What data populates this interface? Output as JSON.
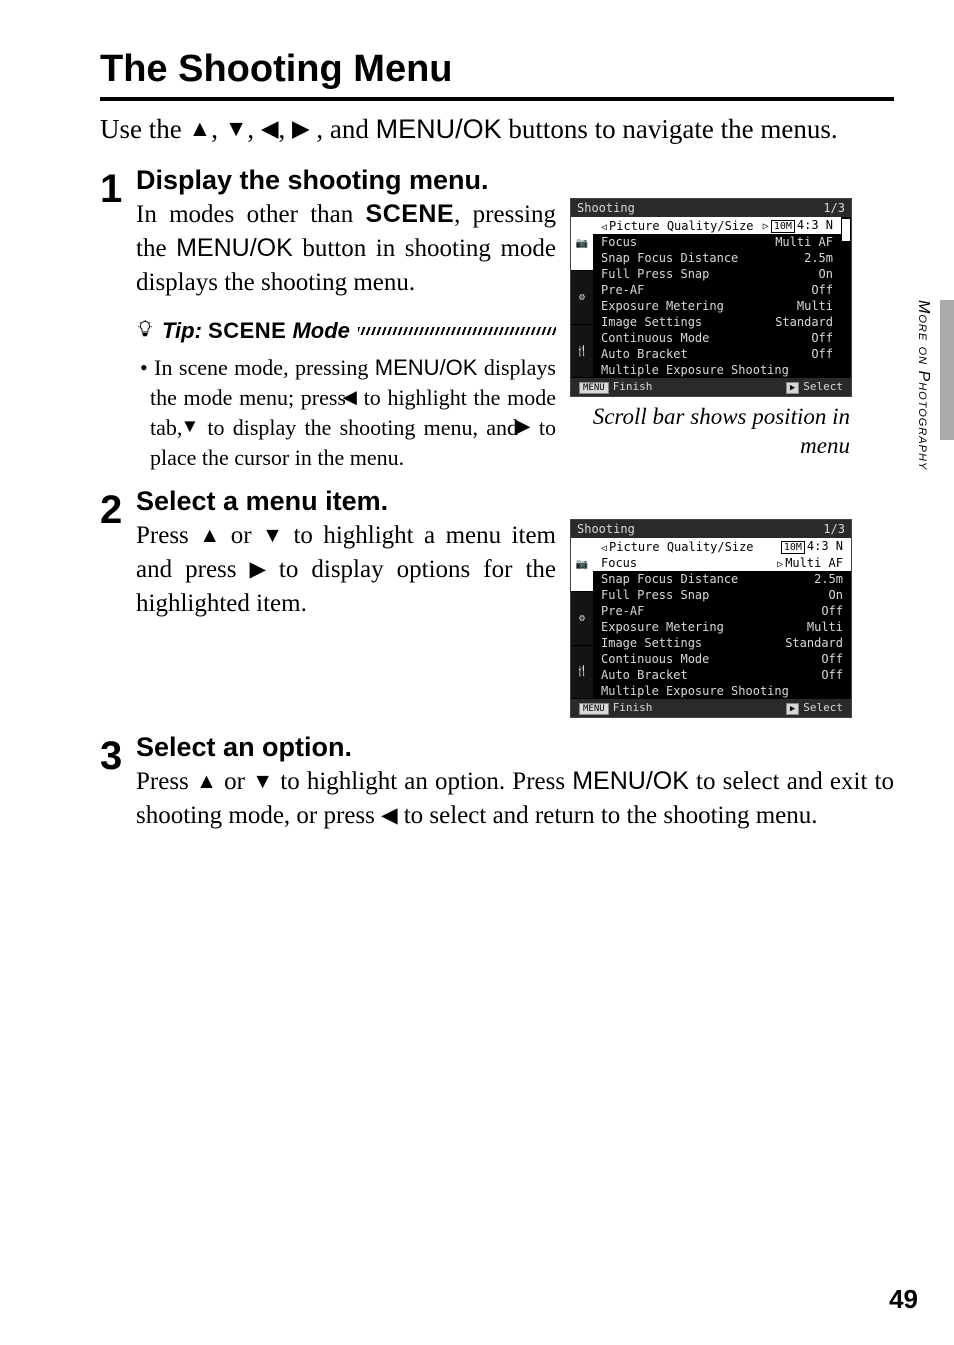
{
  "title": "The Shooting Menu",
  "intro_a": "Use the ",
  "intro_b": ", and ",
  "intro_btn": "MENU/OK",
  "intro_c": " buttons to navigate the menus.",
  "step1": {
    "num": "1",
    "head": "Display the shooting menu.",
    "text_a": "In modes other than ",
    "scene": "SCENE",
    "text_b": ", pressing the ",
    "btn": "MENU/OK",
    "text_c": " button in shooting mode displays the shooting menu."
  },
  "tip": {
    "label": "Tip:",
    "scene": "SCENE",
    "mode": "Mode",
    "bullet": "•",
    "a": "In scene mode, pressing ",
    "btn": "MENU/OK",
    "b": " displays the mode menu; press ",
    "c": " to highlight the mode tab, ",
    "d": " to display the shooting menu, and ",
    "e": " to place the cursor in the menu."
  },
  "caption": "Scroll bar shows position in menu",
  "step2": {
    "num": "2",
    "head": "Select a menu item.",
    "a": "Press ",
    "b": " or ",
    "c": " to highlight a menu item and press ",
    "d": " to display options for the highlighted item."
  },
  "step3": {
    "num": "3",
    "head": "Select an option.",
    "a": "Press ",
    "b": " or ",
    "c": " to highlight an option. Press ",
    "btn": "MENU/OK",
    "d": " to select and exit to shooting mode, or press ",
    "e": " to select and return to the shooting menu."
  },
  "screen": {
    "title": "Shooting",
    "page": "1/3",
    "rail": [
      "📷",
      "⚙",
      "🍴"
    ],
    "rows": [
      {
        "label": "Picture Quality/Size",
        "val": "10M 4:3 N",
        "sel": true,
        "valsel": true,
        "tri": "◁",
        "badge": true,
        "rtri": "▷"
      },
      {
        "label": "Focus",
        "val": "Multi AF"
      },
      {
        "label": "Snap Focus Distance",
        "val": "2.5m"
      },
      {
        "label": "Full Press Snap",
        "val": "On"
      },
      {
        "label": "Pre-AF",
        "val": "Off"
      },
      {
        "label": "Exposure Metering",
        "val": "Multi"
      },
      {
        "label": "Image Settings",
        "val": "Standard"
      },
      {
        "label": "Continuous Mode",
        "val": "Off"
      },
      {
        "label": "Auto Bracket",
        "val": "Off"
      },
      {
        "label": "Multiple Exposure Shooting",
        "val": ""
      }
    ],
    "ftr_left_k": "MENU",
    "ftr_left": "Finish",
    "ftr_right_k": "▶",
    "ftr_right": "Select"
  },
  "screen2": {
    "title": "Shooting",
    "page": "1/3",
    "rail": [
      "📷",
      "⚙",
      "🍴"
    ],
    "rows": [
      {
        "label": "Picture Quality/Size",
        "val": "10M 4:3 N",
        "sel": true,
        "tri": "◁",
        "badge": true
      },
      {
        "label": "Focus",
        "val": "Multi AF",
        "sel2": true,
        "rtri": "▷"
      },
      {
        "label": "Snap Focus Distance",
        "val": "2.5m"
      },
      {
        "label": "Full Press Snap",
        "val": "On"
      },
      {
        "label": "Pre-AF",
        "val": "Off"
      },
      {
        "label": "Exposure Metering",
        "val": "Multi"
      },
      {
        "label": "Image Settings",
        "val": "Standard"
      },
      {
        "label": "Continuous Mode",
        "val": "Off"
      },
      {
        "label": "Auto Bracket",
        "val": "Off"
      },
      {
        "label": "Multiple Exposure Shooting",
        "val": ""
      }
    ],
    "ftr_left_k": "MENU",
    "ftr_left": "Finish",
    "ftr_right_k": "▶",
    "ftr_right": "Select"
  },
  "side": "More on Photography",
  "pagenum": "49",
  "glyph": {
    "up": "▲",
    "down": "▼",
    "left": "◀",
    "right": "▶",
    "sep": ", "
  }
}
